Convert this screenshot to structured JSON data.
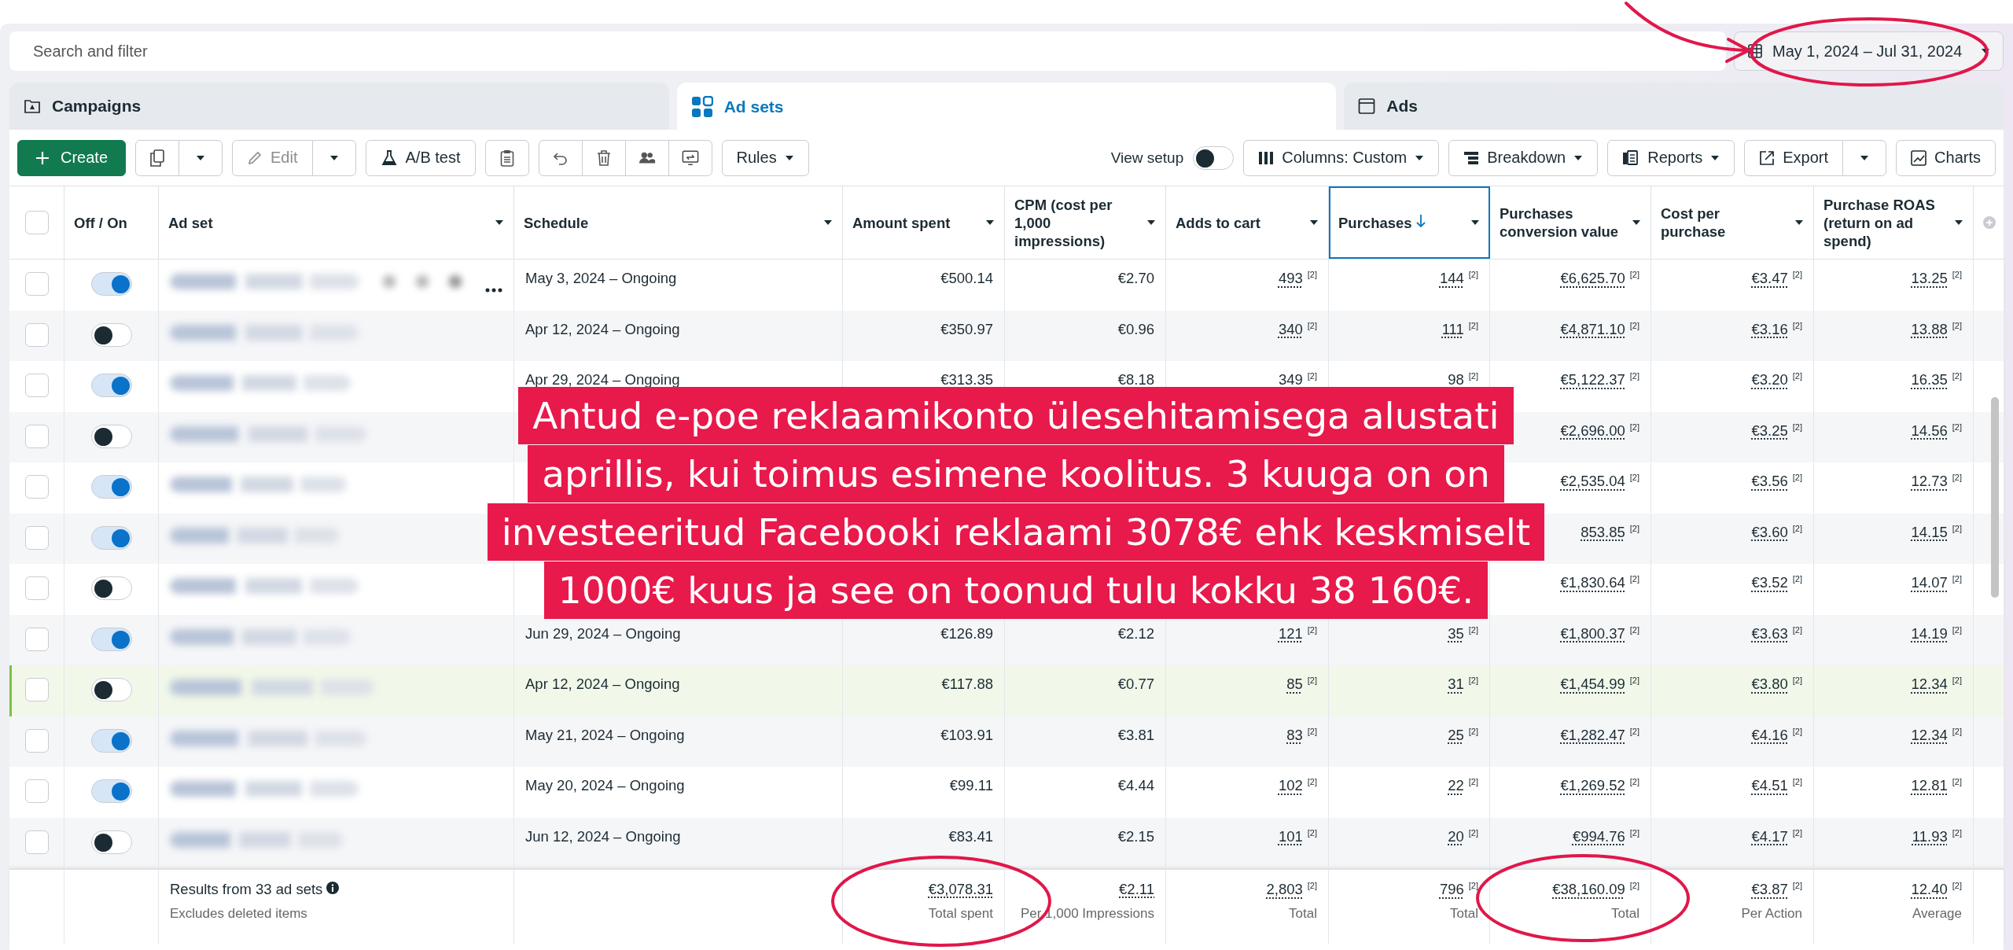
{
  "search": {
    "placeholder": "Search and filter"
  },
  "date_range": {
    "label": "May 1, 2024 – Jul 31, 2024"
  },
  "tabs": [
    {
      "kind": "campaigns",
      "label": "Campaigns",
      "selected": false
    },
    {
      "kind": "adsets",
      "label": "Ad sets",
      "selected": true
    },
    {
      "kind": "ads",
      "label": "Ads",
      "selected": false
    }
  ],
  "toolbar": {
    "create": "Create",
    "edit": {
      "label": "Edit",
      "disabled": true
    },
    "ab_test": "A/B test",
    "rules": "Rules",
    "view_setup": {
      "label": "View setup",
      "on": false
    },
    "columns": "Columns: Custom",
    "breakdown": "Breakdown",
    "reports": "Reports",
    "export": "Export",
    "charts": "Charts"
  },
  "table": {
    "select_all": {
      "checked": false
    },
    "columns": [
      {
        "label": "Off / On",
        "sorted": false
      },
      {
        "label": "Ad set",
        "sorted": false
      },
      {
        "label": "Schedule",
        "sorted": false
      },
      {
        "label": "Amount spent",
        "sorted": false
      },
      {
        "label": "CPM (cost per 1,000 impressions)",
        "sorted": false
      },
      {
        "label": "Adds to cart",
        "sorted": false
      },
      {
        "label": "Purchases",
        "sorted": true
      },
      {
        "label": "Purchases conversion value",
        "sorted": false
      },
      {
        "label": "Cost per purchase",
        "sorted": false
      },
      {
        "label": "Purchase ROAS (return on ad spend)",
        "sorted": false
      }
    ],
    "rows": [
      {
        "checked": false,
        "on": true,
        "highlighted": false,
        "actions": true,
        "schedule": "May 3, 2024 – Ongoing",
        "amount": "€500.14",
        "cpm": "€2.70",
        "adds": {
          "v": "493",
          "r": "[2]"
        },
        "purchases": {
          "v": "144",
          "r": "[2]"
        },
        "value": {
          "v": "€6,625.70",
          "r": "[2]"
        },
        "cost": {
          "v": "€3.47",
          "r": "[2]"
        },
        "roas": {
          "v": "13.25",
          "r": "[2]"
        }
      },
      {
        "checked": false,
        "on": false,
        "highlighted": false,
        "actions": false,
        "schedule": "Apr 12, 2024 – Ongoing",
        "amount": "€350.97",
        "cpm": "€0.96",
        "adds": {
          "v": "340",
          "r": "[2]"
        },
        "purchases": {
          "v": "111",
          "r": "[2]"
        },
        "value": {
          "v": "€4,871.10",
          "r": "[2]"
        },
        "cost": {
          "v": "€3.16",
          "r": "[2]"
        },
        "roas": {
          "v": "13.88",
          "r": "[2]"
        }
      },
      {
        "checked": false,
        "on": true,
        "highlighted": false,
        "actions": false,
        "schedule": "Apr 29, 2024 – Ongoing",
        "amount": "€313.35",
        "cpm": "€8.18",
        "adds": {
          "v": "349",
          "r": "[2]"
        },
        "purchases": {
          "v": "98",
          "r": "[2]"
        },
        "value": {
          "v": "€5,122.37",
          "r": "[2]"
        },
        "cost": {
          "v": "€3.20",
          "r": "[2]"
        },
        "roas": {
          "v": "16.35",
          "r": "[2]"
        }
      },
      {
        "checked": false,
        "on": false,
        "highlighted": false,
        "actions": false,
        "value": {
          "v": "€2,696.00",
          "r": "[2]"
        },
        "cost": {
          "v": "€3.25",
          "r": "[2]"
        },
        "roas": {
          "v": "14.56",
          "r": "[2]"
        }
      },
      {
        "checked": false,
        "on": true,
        "highlighted": false,
        "actions": false,
        "value": {
          "v": "€2,535.04",
          "r": "[2]"
        },
        "cost": {
          "v": "€3.56",
          "r": "[2]"
        },
        "roas": {
          "v": "12.73",
          "r": "[2]"
        }
      },
      {
        "checked": false,
        "on": true,
        "highlighted": false,
        "actions": false,
        "value": {
          "v": "853.85",
          "r": "[2]"
        },
        "cost": {
          "v": "€3.60",
          "r": "[2]"
        },
        "roas": {
          "v": "14.15",
          "r": "[2]"
        }
      },
      {
        "checked": false,
        "on": false,
        "highlighted": false,
        "actions": false,
        "value": {
          "v": "€1,830.64",
          "r": "[2]"
        },
        "cost": {
          "v": "€3.52",
          "r": "[2]"
        },
        "roas": {
          "v": "14.07",
          "r": "[2]"
        }
      },
      {
        "checked": false,
        "on": true,
        "highlighted": false,
        "actions": false,
        "schedule": "Jun 29, 2024 – Ongoing",
        "amount": "€126.89",
        "cpm": "€2.12",
        "adds": {
          "v": "121",
          "r": "[2]"
        },
        "purchases": {
          "v": "35",
          "r": "[2]"
        },
        "value": {
          "v": "€1,800.37",
          "r": "[2]"
        },
        "cost": {
          "v": "€3.63",
          "r": "[2]"
        },
        "roas": {
          "v": "14.19",
          "r": "[2]"
        }
      },
      {
        "checked": false,
        "on": false,
        "highlighted": true,
        "actions": false,
        "schedule": "Apr 12, 2024 – Ongoing",
        "amount": "€117.88",
        "cpm": "€0.77",
        "adds": {
          "v": "85",
          "r": "[2]"
        },
        "purchases": {
          "v": "31",
          "r": "[2]"
        },
        "value": {
          "v": "€1,454.99",
          "r": "[2]"
        },
        "cost": {
          "v": "€3.80",
          "r": "[2]"
        },
        "roas": {
          "v": "12.34",
          "r": "[2]"
        }
      },
      {
        "checked": false,
        "on": true,
        "highlighted": false,
        "actions": false,
        "schedule": "May 21, 2024 – Ongoing",
        "amount": "€103.91",
        "cpm": "€3.81",
        "adds": {
          "v": "83",
          "r": "[2]"
        },
        "purchases": {
          "v": "25",
          "r": "[2]"
        },
        "value": {
          "v": "€1,282.47",
          "r": "[2]"
        },
        "cost": {
          "v": "€4.16",
          "r": "[2]"
        },
        "roas": {
          "v": "12.34",
          "r": "[2]"
        }
      },
      {
        "checked": false,
        "on": true,
        "highlighted": false,
        "actions": false,
        "schedule": "May 20, 2024 – Ongoing",
        "amount": "€99.11",
        "cpm": "€4.44",
        "adds": {
          "v": "102",
          "r": "[2]"
        },
        "purchases": {
          "v": "22",
          "r": "[2]"
        },
        "value": {
          "v": "€1,269.52",
          "r": "[2]"
        },
        "cost": {
          "v": "€4.51",
          "r": "[2]"
        },
        "roas": {
          "v": "12.81",
          "r": "[2]"
        }
      },
      {
        "checked": false,
        "on": false,
        "highlighted": false,
        "actions": false,
        "schedule": "Jun 12, 2024 – Ongoing",
        "amount": "€83.41",
        "cpm": "€2.15",
        "adds": {
          "v": "101",
          "r": "[2]"
        },
        "purchases": {
          "v": "20",
          "r": "[2]"
        },
        "value": {
          "v": "€994.76",
          "r": "[2]"
        },
        "cost": {
          "v": "€4.17",
          "r": "[2]"
        },
        "roas": {
          "v": "11.93",
          "r": "[2]"
        }
      }
    ],
    "footer": {
      "label": "Results from 33 ad sets",
      "sub": "Excludes deleted items",
      "totals": [
        {
          "v": "€3,078.31",
          "note": "Total spent"
        },
        {
          "v": "€2.11",
          "note": "Per 1,000 Impressions"
        },
        {
          "v": "2,803",
          "r": "[2]",
          "note": "Total"
        },
        {
          "v": "796",
          "r": "[2]",
          "note": "Total"
        },
        {
          "v": "€38,160.09",
          "r": "[2]",
          "note": "Total"
        },
        {
          "v": "€3.87",
          "r": "[2]",
          "note": "Per Action"
        },
        {
          "v": "12.40",
          "r": "[2]",
          "note": "Average"
        }
      ]
    }
  },
  "note": {
    "text": "Antud e-poe reklaamikonto ülesehitamisega alustati\naprillis, kui toimus esimene koolitus. 3 kuuga on on\ninvesteeritud Facebooki reklaami 3078€ ehk keskmiselt\n1000€ kuus ja see on toonud tulu kokku 38 160€."
  }
}
